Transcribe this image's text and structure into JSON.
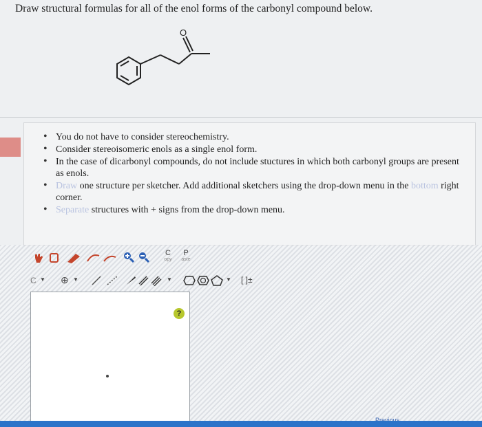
{
  "question": "Draw structural formulas for all of the enol forms of the carbonyl compound below.",
  "molecule": {
    "oxygen_label": "O"
  },
  "instructions": [
    {
      "text": "You do not have to consider stereochemistry."
    },
    {
      "text": "Consider stereoisomeric enols as a single enol form."
    },
    {
      "text": "In the case of dicarbonyl compounds, do not include stuctures in which both carbonyl groups are present as enols."
    },
    {
      "faded": "Draw",
      "text": " one structure per sketcher. Add additional sketchers using the drop-down menu in the ",
      "faded2": "bottom",
      "text2": " right corner."
    },
    {
      "faded": "Separate",
      "text": " structures with + signs from the drop-down menu."
    }
  ],
  "toolbar": {
    "copy_letter": "C",
    "copy_label": "opy",
    "paste_letter": "P",
    "paste_label": "aste",
    "carbon_label": "C",
    "charge_label": "⊕",
    "bracket_label": "[ ]±"
  },
  "help_label": "?",
  "corner_link": "Previous",
  "colors": {
    "accent_blue": "#2b73c9",
    "help_green": "#b7c72d",
    "eraser_red": "#c4452c"
  }
}
